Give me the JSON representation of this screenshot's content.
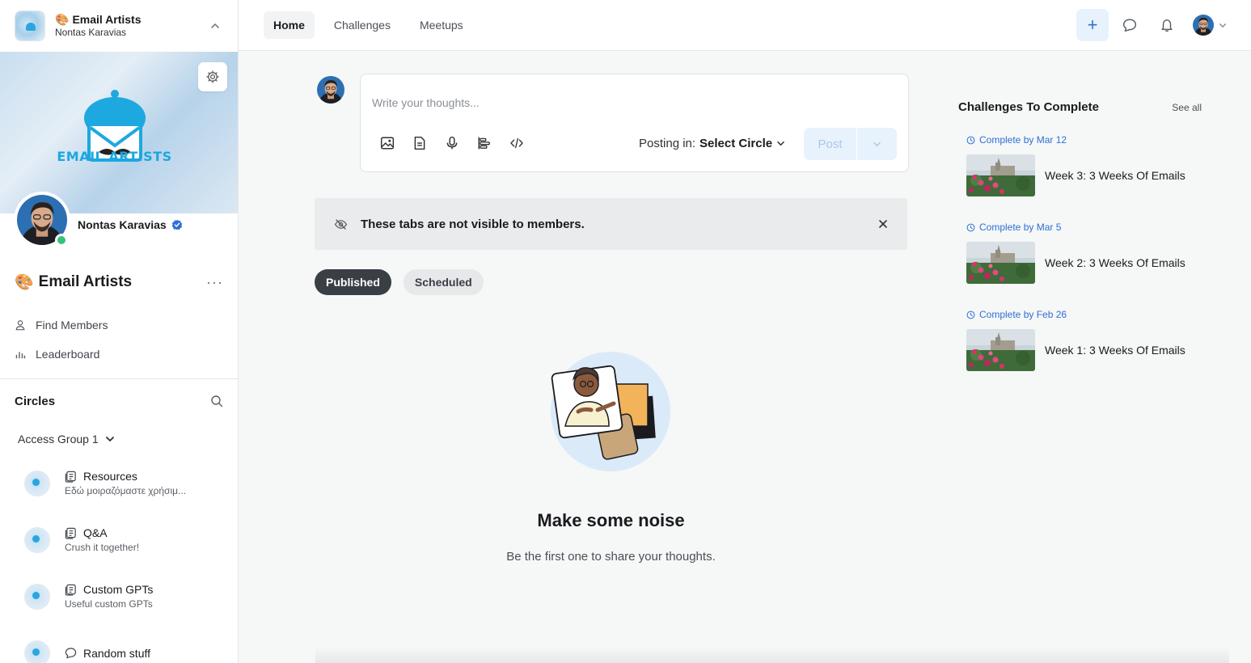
{
  "workspace": {
    "emoji": "🎨",
    "name": "Email Artists",
    "owner": "Nontas Karavias"
  },
  "cover": {
    "brand_text": "EMAIL ARTISTS"
  },
  "profile": {
    "name": "Nontas Karavias"
  },
  "community": {
    "emoji": "🎨",
    "title": "Email Artists",
    "menu": "···"
  },
  "nav": {
    "items": [
      {
        "label": "Find Members",
        "icon": "person-icon"
      },
      {
        "label": "Leaderboard",
        "icon": "leaderboard-icon"
      }
    ]
  },
  "circles": {
    "title": "Circles",
    "access_group": "Access Group 1",
    "items": [
      {
        "name": "Resources",
        "desc": "Εδώ μοιραζόμαστε χρήσιμ...",
        "icon": "doc-icon"
      },
      {
        "name": "Q&A",
        "desc": "Crush it together!",
        "icon": "doc-icon"
      },
      {
        "name": "Custom GPTs",
        "desc": "Useful custom GPTs",
        "icon": "doc-icon"
      },
      {
        "name": "Random stuff",
        "desc": "",
        "icon": "chat-icon"
      }
    ]
  },
  "topbar": {
    "tabs": [
      "Home",
      "Challenges",
      "Meetups"
    ],
    "active_tab": "Home",
    "plus": "+"
  },
  "composer": {
    "placeholder": "Write your thoughts...",
    "posting_in_label": "Posting in:",
    "posting_in_value": "Select Circle",
    "post_label": "Post"
  },
  "notice": {
    "text": "These tabs are not visible to members."
  },
  "filters": [
    "Published",
    "Scheduled"
  ],
  "empty_state": {
    "title": "Make some noise",
    "subtitle": "Be the first one to share your thoughts."
  },
  "challenges": {
    "title": "Challenges To Complete",
    "see_all": "See all",
    "items": [
      {
        "date": "Complete by Mar 12",
        "name": "Week 3: 3 Weeks Of Emails"
      },
      {
        "date": "Complete by Mar 5",
        "name": "Week 2: 3 Weeks Of Emails"
      },
      {
        "date": "Complete by Feb 26",
        "name": "Week 1: 3 Weeks Of Emails"
      }
    ]
  },
  "colors": {
    "accent": "#2f6fd6",
    "online": "#35c27a",
    "brand": "#1ca7e0"
  }
}
